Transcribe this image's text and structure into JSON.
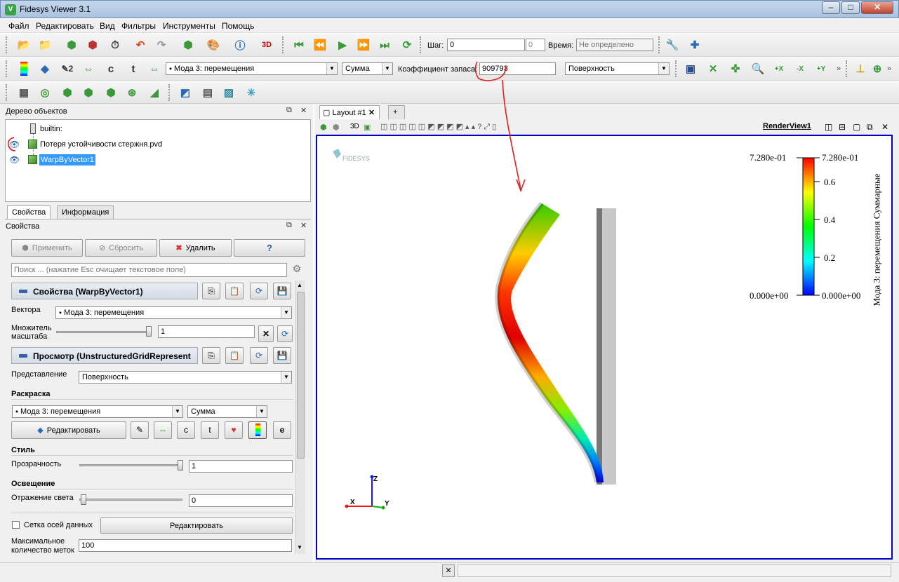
{
  "window": {
    "title": "Fidesys Viewer 3.1",
    "minimize": "–",
    "maximize": "□",
    "close": "✕"
  },
  "menu": [
    "Файл",
    "Редактировать",
    "Вид",
    "Фильтры",
    "Инструменты",
    "Помощь"
  ],
  "toolbar1": {
    "step_label": "Шаг:",
    "step_value": "0",
    "step_max": "0",
    "time_label": "Время:",
    "time_value": "Не определено"
  },
  "toolbar2": {
    "field_select": "Мода 3: перемещения",
    "component_select": "Сумма",
    "safety_label": "Коэффициент запаса:",
    "safety_value": "909793",
    "representation_select": "Поверхность"
  },
  "pipeline": {
    "title": "Дерево объектов",
    "items": [
      {
        "label": "builtin:"
      },
      {
        "label": "Потеря устойчивости стержня.pvd"
      },
      {
        "label": "WarpByVector1"
      }
    ]
  },
  "tabs": {
    "properties": "Свойства",
    "information": "Информация"
  },
  "properties": {
    "title": "Свойства",
    "apply": "Применить",
    "reset": "Сбросить",
    "delete": "Удалить",
    "help": "?",
    "search_placeholder": "Поиск ... (нажатие Esc очищает текстовое поле)",
    "section_filter": "Свойства (WarpByVector1)",
    "vectors_label": "Вектора",
    "vectors_value": "Мода 3: перемещения",
    "scale_label": "Множитель масштаба",
    "scale_value": "1",
    "section_view": "Просмотр (UnstructuredGridRepresent",
    "representation_label": "Представление",
    "representation_value": "Поверхность",
    "coloring_title": "Раскраска",
    "coloring_field": "Мода 3: перемещения",
    "coloring_component": "Сумма",
    "edit_button": "Редактировать",
    "style_title": "Стиль",
    "opacity_label": "Прозрачность",
    "opacity_value": "1",
    "lighting_title": "Освещение",
    "specular_label": "Отражение света",
    "specular_value": "0",
    "axes_grid_label": "Сетка осей данных",
    "axes_grid_edit": "Редактировать",
    "max_labels_label": "Максимальное количество меток",
    "max_labels_value": "100"
  },
  "view": {
    "layout_tab": "Layout #1",
    "add_tab": "+",
    "threeD": "3D",
    "render_view": "RenderView1",
    "logo": "FIDESYS"
  },
  "colorbar": {
    "title": "Мода 3: перемещения Суммарные",
    "top": "7.280e-01",
    "bottom": "0.000e+00",
    "ticks": [
      "0.6",
      "0.4",
      "0.2"
    ],
    "colors": [
      "#ff0000",
      "#ffff00",
      "#00ff00",
      "#00ffff",
      "#0000ff"
    ]
  },
  "axes": {
    "z": "Z",
    "x": "X",
    "y": "Y"
  }
}
